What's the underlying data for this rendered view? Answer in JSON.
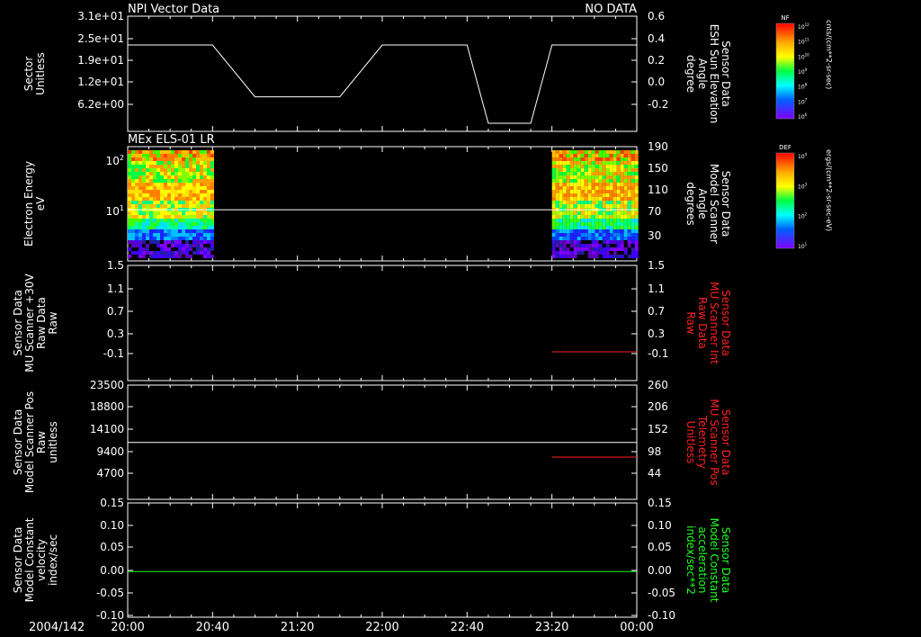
{
  "time_axis": {
    "date_label": "2004/142",
    "ticks": [
      "20:00",
      "20:40",
      "21:20",
      "22:00",
      "22:40",
      "23:20",
      "00:00"
    ]
  },
  "colorbars": [
    {
      "label": "NF",
      "unit": "cnts/(cm**2-sr-sec)",
      "ticks": [
        "10^12",
        "10^11",
        "10^10",
        "10^9",
        "10^8",
        "10^7",
        "10^6"
      ]
    },
    {
      "label": "DEF",
      "unit": "ergs/(cm**2-sr-sec-eV)",
      "ticks": [
        "10^4",
        "10^3",
        "10^2",
        "10^1"
      ]
    }
  ],
  "chart_data": [
    {
      "type": "line",
      "title": "NPI Vector Data",
      "status": "NO DATA",
      "ylabel_left": [
        "Sector",
        "Unitless"
      ],
      "yticks_left": [
        "3.1e+01",
        "2.5e+01",
        "1.9e+01",
        "1.2e+01",
        "6.2e+00"
      ],
      "ylabel_right": [
        "Sensor Data",
        "ESH Sun Elevation",
        "Angle",
        "degree"
      ],
      "yticks_right": [
        "0.6",
        "0.4",
        "0.2",
        "0.0",
        "-0.2"
      ],
      "ylim_right": [
        -0.4,
        0.6
      ],
      "series": [
        {
          "color": "#ffffff",
          "x": [
            "20:00",
            "20:40",
            "21:00",
            "21:40",
            "22:00",
            "22:20",
            "22:40",
            "22:50",
            "23:10",
            "23:20",
            "00:00"
          ],
          "y": [
            0.35,
            0.35,
            -0.1,
            -0.1,
            0.35,
            0.35,
            0.35,
            -0.33,
            -0.33,
            0.35,
            0.35
          ]
        }
      ]
    },
    {
      "type": "heatmap",
      "title": "MEx ELS-01 LR",
      "ylabel_left": [
        "Electron Energy",
        "eV"
      ],
      "yticks_left": [
        "10^2",
        "10^1"
      ],
      "ylabel_right": [
        "Sensor Data",
        "Model Scanner",
        "Angle",
        "degrees"
      ],
      "yticks_right": [
        "190",
        "150",
        "110",
        "70",
        "30"
      ],
      "data_intervals": [
        [
          "20:00",
          "20:40"
        ],
        [
          "23:20",
          "00:00"
        ]
      ],
      "series": [
        {
          "color": "#ffffff",
          "x": [
            "20:00",
            "00:00"
          ],
          "y": [
            95,
            95
          ]
        }
      ]
    },
    {
      "type": "line",
      "ylabel_left": [
        "Sensor Data",
        "MU Scanner +30V",
        "Raw Data",
        "Raw"
      ],
      "yticks_left": [
        "1.5",
        "1.1",
        "0.7",
        "0.3",
        "-0.1"
      ],
      "ylabel_right": [
        "Sensor Data",
        "MU Scanner Int",
        "Raw Data",
        "Raw"
      ],
      "yticks_right": [
        "1.5",
        "1.1",
        "0.7",
        "0.3",
        "-0.1"
      ],
      "ylim": [
        -0.5,
        1.5
      ],
      "series": [
        {
          "color": "#ff2020",
          "x": [
            "23:20",
            "00:00"
          ],
          "y": [
            0.0,
            0.0
          ]
        }
      ]
    },
    {
      "type": "line",
      "ylabel_left": [
        "Sensor Data",
        "Model Scanner Pos",
        "Raw",
        "unitless"
      ],
      "yticks_left": [
        "23500",
        "18800",
        "14100",
        "9400",
        "4700"
      ],
      "ylabel_right": [
        "Sensor Data",
        "MU Scanner Pos",
        "Telemetry",
        "Unitless"
      ],
      "yticks_right": [
        "260",
        "206",
        "152",
        "98",
        "44"
      ],
      "ylim_left": [
        0,
        23500
      ],
      "ylim_right": [
        -10,
        260
      ],
      "series": [
        {
          "color": "#ffffff",
          "axis": "left",
          "x": [
            "20:00",
            "00:00"
          ],
          "y": [
            11700,
            11700
          ]
        },
        {
          "color": "#ff2020",
          "axis": "right",
          "x": [
            "23:20",
            "00:00"
          ],
          "y": [
            90,
            90
          ]
        }
      ]
    },
    {
      "type": "line",
      "ylabel_left": [
        "Sensor Data",
        "Model Constant",
        "velocity",
        "index/sec"
      ],
      "yticks_left": [
        "0.15",
        "0.10",
        "0.05",
        "0.00",
        "-0.05",
        "-0.10"
      ],
      "ylabel_right": [
        "Sensor Data",
        "Model Constant",
        "acceleration",
        "index/sec**2"
      ],
      "yticks_right": [
        "0.15",
        "0.10",
        "0.05",
        "0.00",
        "-0.05",
        "-0.10"
      ],
      "ylim": [
        -0.1,
        0.15
      ],
      "series": [
        {
          "color": "#20ff20",
          "x": [
            "20:00",
            "00:00"
          ],
          "y": [
            0.0,
            0.0
          ]
        }
      ]
    }
  ]
}
